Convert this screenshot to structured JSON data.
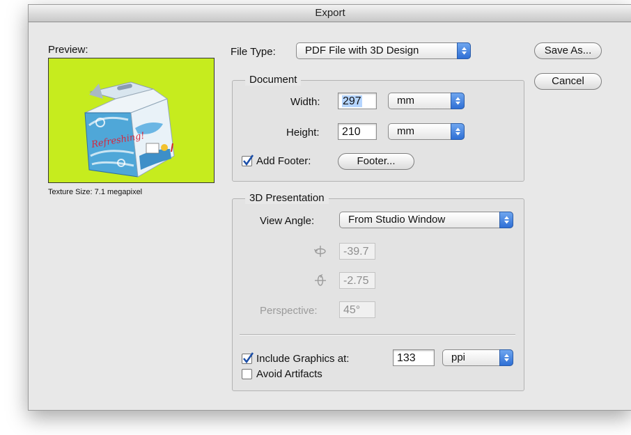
{
  "window": {
    "title": "Export"
  },
  "preview": {
    "label": "Preview:",
    "texture_size": "Texture Size: 7.1 megapixel",
    "box_text": "Refreshing!",
    "background_color": "#c6ec1e"
  },
  "file_type": {
    "label": "File Type:",
    "value": "PDF File with 3D Design"
  },
  "document": {
    "title": "Document",
    "width_label": "Width:",
    "width_value": "297",
    "width_unit": "mm",
    "height_label": "Height:",
    "height_value": "210",
    "height_unit": "mm",
    "add_footer_label": "Add Footer:",
    "add_footer_checked": true,
    "footer_button": "Footer..."
  },
  "presentation": {
    "title": "3D Presentation",
    "view_angle_label": "View Angle:",
    "view_angle_value": "From Studio Window",
    "rotate_vertical_value": "-39.7",
    "rotate_horizontal_value": "-2.75",
    "perspective_label": "Perspective:",
    "perspective_value": "45°",
    "include_graphics_label": "Include Graphics at:",
    "include_graphics_checked": true,
    "include_graphics_value": "133",
    "include_graphics_unit": "ppi",
    "avoid_artifacts_label": "Avoid Artifacts",
    "avoid_artifacts_checked": false
  },
  "buttons": {
    "save_as": "Save As...",
    "cancel": "Cancel"
  }
}
